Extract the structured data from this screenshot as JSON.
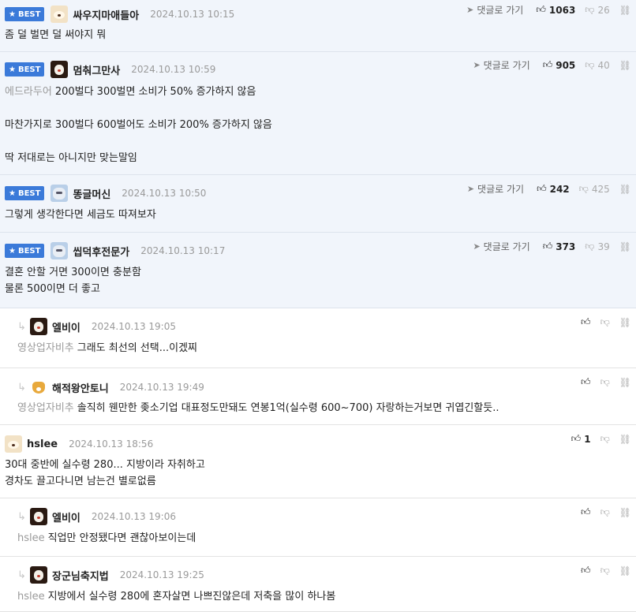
{
  "labels": {
    "best_badge": "BEST",
    "goto_comment": "댓글로 가기"
  },
  "comments": [
    {
      "best": true,
      "avatar": "pomeranian-avatar",
      "nick": "싸우지마애들아",
      "time": "2024.10.13 10:15",
      "up": "1063",
      "down": "26",
      "mention": "",
      "lines": [
        "좀 덜 벌면 덜 써야지 뭐"
      ]
    },
    {
      "best": true,
      "avatar": "dog-avatar",
      "nick": "멈춰그만사",
      "time": "2024.10.13 10:59",
      "up": "905",
      "down": "40",
      "mention": "에드라두어",
      "lines": [
        "200벌다 300벌면 소비가 50% 증가하지 않음",
        "",
        "마찬가지로 300벌다 600벌어도 소비가 200% 증가하지 않음",
        "",
        "딱 저대로는 아니지만 맞는말임"
      ]
    },
    {
      "best": true,
      "avatar": "cat-avatar",
      "nick": "똥글머신",
      "time": "2024.10.13 10:50",
      "up": "242",
      "down": "425",
      "mention": "",
      "lines": [
        "그렇게 생각한다면 세금도 따져보자"
      ]
    },
    {
      "best": true,
      "avatar": "cat-avatar",
      "nick": "씹덕후전문가",
      "time": "2024.10.13 10:17",
      "up": "373",
      "down": "39",
      "mention": "",
      "lines": [
        "결혼 안할 거면 300이면 충분함",
        "물론 500이면 더 좋고"
      ]
    },
    {
      "reply": true,
      "avatar": "dog-avatar",
      "nick": "엘비이",
      "time": "2024.10.13 19:05",
      "up": "",
      "mention": "영상업자비추",
      "lines": [
        "그래도 최선의 선택...이겠찌"
      ]
    },
    {
      "reply": true,
      "avatar": "fox-avatar",
      "nick": "해적왕안토니",
      "time": "2024.10.13 19:49",
      "up": "",
      "mention": "영상업자비추",
      "lines": [
        "솔직히 웬만한 좆소기업 대표정도만돼도 연봉1억(실수령 600~700) 자랑하는거보면 귀엽긴할듯.."
      ]
    },
    {
      "reply": false,
      "avatar": "pomeranian-avatar",
      "nick": "hslee",
      "time": "2024.10.13 18:56",
      "up": "1",
      "mention": "",
      "lines": [
        "30대 중반에 실수령 280... 지방이라 자취하고",
        "경차도 끌고다니면 남는건 별로없름"
      ]
    },
    {
      "reply": true,
      "avatar": "dog-avatar",
      "nick": "엘비이",
      "time": "2024.10.13 19:06",
      "up": "",
      "mention": "hslee",
      "lines": [
        "직업만 안정됐다면 괜찮아보이는데"
      ]
    },
    {
      "reply": true,
      "avatar": "dog-avatar",
      "nick": "장군님축지법",
      "time": "2024.10.13 19:25",
      "up": "",
      "mention": "hslee",
      "lines": [
        "지방에서 실수령 280에 혼자살면 나쁘진않은데 저축을 많이 하나봄"
      ]
    }
  ]
}
